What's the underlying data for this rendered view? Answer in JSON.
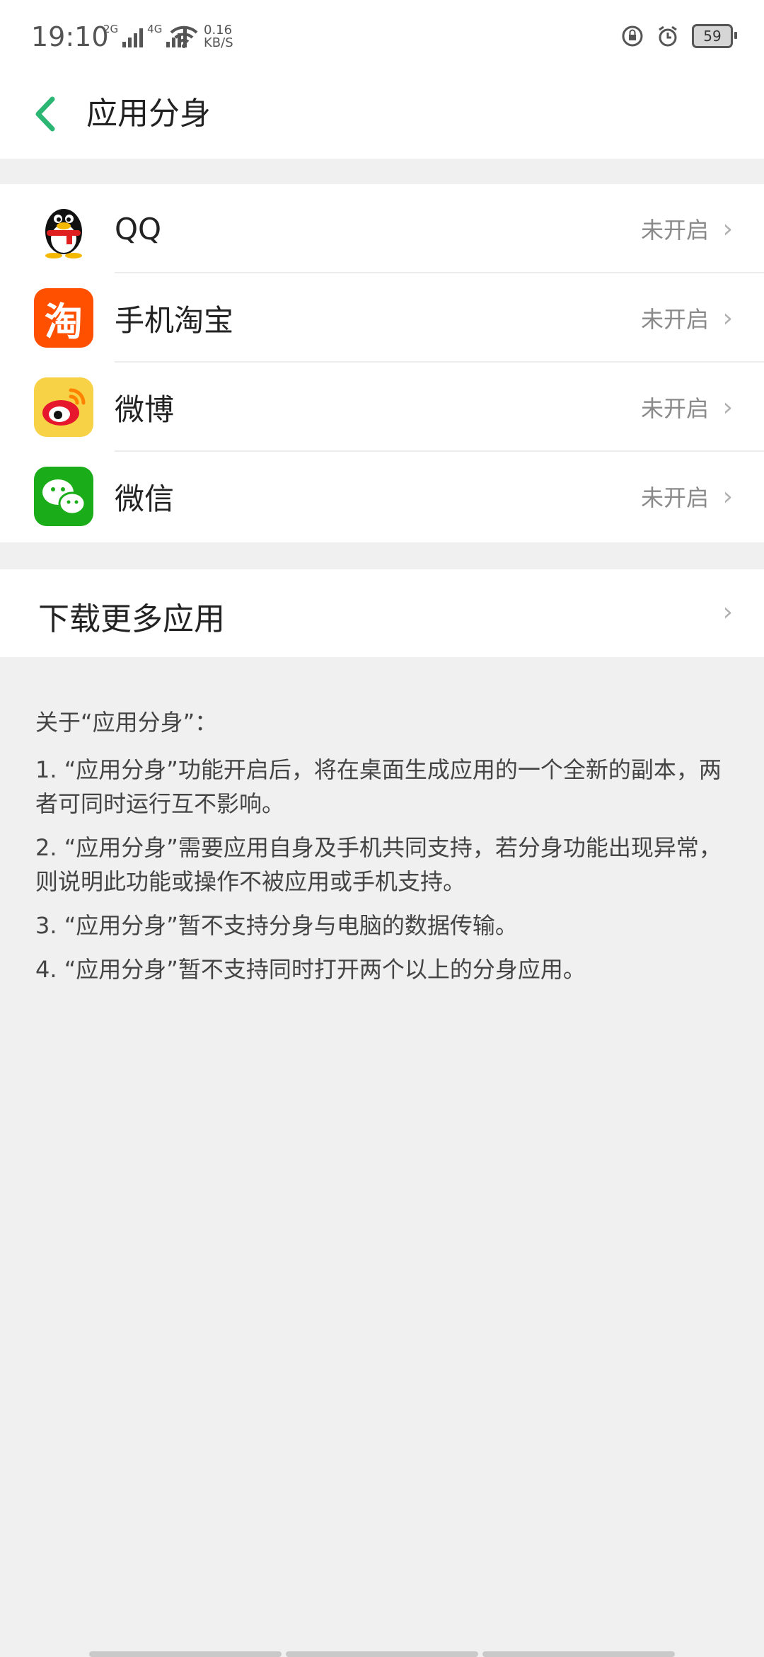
{
  "status_bar": {
    "time": "19:10",
    "net1": "2G",
    "net2": "4G",
    "speed_value": "0.16",
    "speed_unit": "KB/S",
    "battery": "59"
  },
  "header": {
    "title": "应用分身"
  },
  "apps": [
    {
      "name": "QQ",
      "status": "未开启",
      "icon": "qq-penguin-icon"
    },
    {
      "name": "手机淘宝",
      "status": "未开启",
      "icon": "taobao-icon",
      "icon_glyph": "淘"
    },
    {
      "name": "微博",
      "status": "未开启",
      "icon": "weibo-icon"
    },
    {
      "name": "微信",
      "status": "未开启",
      "icon": "wechat-icon"
    }
  ],
  "more": {
    "label": "下载更多应用"
  },
  "notes": {
    "title": "关于“应用分身”：",
    "items": [
      "1. “应用分身”功能开启后，将在桌面生成应用的一个全新的副本，两者可同时运行互不影响。",
      "2. “应用分身”需要应用自身及手机共同支持，若分身功能出现异常，则说明此功能或操作不被应用或手机支持。",
      "3. “应用分身”暂不支持分身与电脑的数据传输。",
      "4. “应用分身”暂不支持同时打开两个以上的分身应用。"
    ]
  },
  "colors": {
    "accent": "#2bb673",
    "taobao": "#ff5000",
    "weibo_bg": "#f7d146",
    "wechat": "#1aad19"
  }
}
